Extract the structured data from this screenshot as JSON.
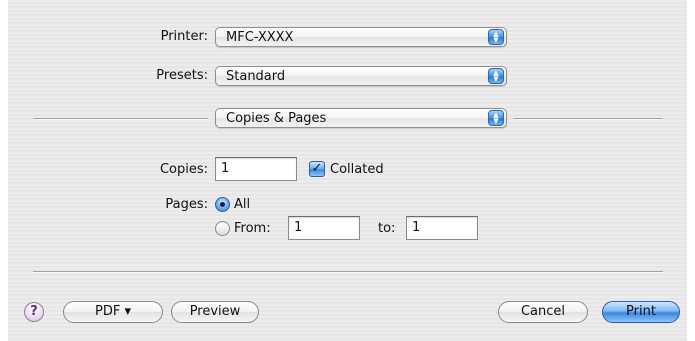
{
  "printer": {
    "label": "Printer:",
    "selected": "MFC-XXXX"
  },
  "presets": {
    "label": "Presets:",
    "selected": "Standard"
  },
  "panel": {
    "selected": "Copies & Pages"
  },
  "copies": {
    "label": "Copies:",
    "value": "1",
    "collated_label": "Collated",
    "collated_checked": true
  },
  "pages": {
    "label": "Pages:",
    "all_label": "All",
    "all_selected": true,
    "from_label": "From:",
    "from_value": "1",
    "to_label": "to:",
    "to_value": "1"
  },
  "buttons": {
    "help": "?",
    "pdf": "PDF ▾",
    "preview": "Preview",
    "cancel": "Cancel",
    "print": "Print"
  },
  "icons": {
    "popup_arrows": "up-down-arrows-icon",
    "checkmark": "checkmark-icon",
    "help": "question-mark-icon"
  }
}
